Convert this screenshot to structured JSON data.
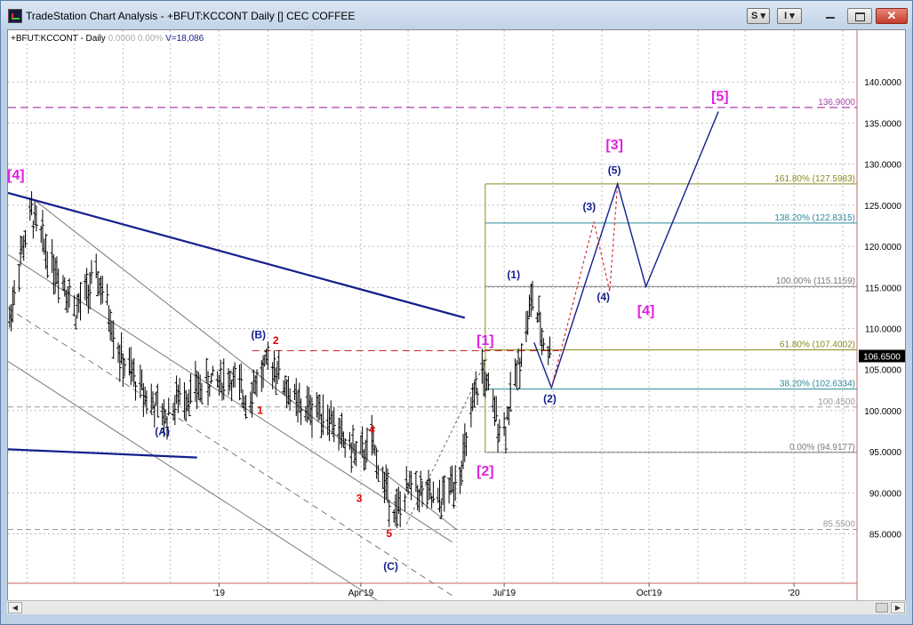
{
  "window": {
    "title": "TradeStation Chart Analysis - +BFUT:KCCONT Daily [] CEC COFFEE",
    "btn_s": "S",
    "btn_i": "I",
    "close_symbol": "✕"
  },
  "colors": {
    "price_bars": "#000000",
    "channel": "#7a7a7a",
    "trend_line": "#141e8c",
    "red_label": "#e00000",
    "magenta_label": "#e020e0",
    "blue_label": "#141e8c",
    "fib": "#7a7a7a",
    "fib_olive": "#8a8a20",
    "fib_teal": "#2a8a9a",
    "target_line": "#b040b0",
    "price_flag_bg": "#000000",
    "price_flag_fg": "#ffffff"
  },
  "chart_data": {
    "type": "ohlc-bar",
    "symbol_line": {
      "symbol": "+BFUT:KCCONT - Daily",
      "last": "0.0000",
      "change": "0.00%",
      "volume": "V=18,086"
    },
    "xaxis": {
      "tick_labels": [
        "'19",
        "Apr'19",
        "Jul'19",
        "Oct'19",
        "'20"
      ],
      "tick_dates": [
        "2019-01-01",
        "2019-04-01",
        "2019-07-01",
        "2019-10-01",
        "2020-01-01"
      ],
      "range": [
        "2018-08-20",
        "2020-02-10"
      ]
    },
    "yaxis": {
      "range": [
        79.0,
        146.3
      ],
      "tick_labels": [
        "85.0000",
        "90.0000",
        "95.0000",
        "100.0000",
        "105.0000",
        "110.0000",
        "115.0000",
        "120.0000",
        "125.0000",
        "130.0000",
        "135.0000",
        "140.0000"
      ],
      "ticks": [
        85,
        90,
        95,
        100,
        105,
        110,
        115,
        120,
        125,
        130,
        135,
        140
      ],
      "current_price_label": "106.6500",
      "current_price": 106.65
    },
    "price_series": [
      {
        "date": "2018-08-21",
        "value": 111.0
      },
      {
        "date": "2018-08-27",
        "value": 118.0
      },
      {
        "date": "2018-09-04",
        "value": 124.0
      },
      {
        "date": "2018-09-10",
        "value": 121.0
      },
      {
        "date": "2018-09-17",
        "value": 118.0
      },
      {
        "date": "2018-09-25",
        "value": 115.5
      },
      {
        "date": "2018-10-02",
        "value": 112.0
      },
      {
        "date": "2018-10-09",
        "value": 114.5
      },
      {
        "date": "2018-10-16",
        "value": 116.0
      },
      {
        "date": "2018-10-23",
        "value": 112.0
      },
      {
        "date": "2018-10-31",
        "value": 106.0
      },
      {
        "date": "2018-11-08",
        "value": 104.0
      },
      {
        "date": "2018-11-19",
        "value": 101.0
      },
      {
        "date": "2018-11-28",
        "value": 99.0
      },
      {
        "date": "2018-12-06",
        "value": 101.5
      },
      {
        "date": "2018-12-17",
        "value": 102.5
      },
      {
        "date": "2018-12-27",
        "value": 103.5
      },
      {
        "date": "2019-01-08",
        "value": 104.0
      },
      {
        "date": "2019-01-18",
        "value": 101.5
      },
      {
        "date": "2019-01-28",
        "value": 104.5
      },
      {
        "date": "2019-02-04",
        "value": 106.0
      },
      {
        "date": "2019-02-12",
        "value": 103.0
      },
      {
        "date": "2019-02-22",
        "value": 100.0
      },
      {
        "date": "2019-03-04",
        "value": 100.5
      },
      {
        "date": "2019-03-13",
        "value": 99.0
      },
      {
        "date": "2019-03-22",
        "value": 96.0
      },
      {
        "date": "2019-04-01",
        "value": 94.5
      },
      {
        "date": "2019-04-08",
        "value": 96.0
      },
      {
        "date": "2019-04-15",
        "value": 91.5
      },
      {
        "date": "2019-04-24",
        "value": 87.5
      },
      {
        "date": "2019-05-03",
        "value": 91.0
      },
      {
        "date": "2019-05-10",
        "value": 90.0
      },
      {
        "date": "2019-05-20",
        "value": 88.5
      },
      {
        "date": "2019-05-29",
        "value": 91.0
      },
      {
        "date": "2019-06-05",
        "value": 94.0
      },
      {
        "date": "2019-06-12",
        "value": 101.0
      },
      {
        "date": "2019-06-17",
        "value": 105.0
      },
      {
        "date": "2019-06-24",
        "value": 100.0
      },
      {
        "date": "2019-07-01",
        "value": 97.5
      },
      {
        "date": "2019-07-08",
        "value": 104.0
      },
      {
        "date": "2019-07-15",
        "value": 110.0
      },
      {
        "date": "2019-07-19",
        "value": 114.0
      },
      {
        "date": "2019-07-25",
        "value": 109.0
      },
      {
        "date": "2019-07-31",
        "value": 106.5
      }
    ],
    "channel_lines": [
      {
        "style": "solid",
        "points": [
          {
            "date": "2018-08-20",
            "value": 119.0
          },
          {
            "date": "2019-05-29",
            "value": 84.0
          }
        ]
      },
      {
        "style": "dashed",
        "points": [
          {
            "date": "2018-08-20",
            "value": 112.5
          },
          {
            "date": "2019-05-29",
            "value": 77.5
          }
        ]
      },
      {
        "style": "solid",
        "points": [
          {
            "date": "2018-08-20",
            "value": 106.0
          },
          {
            "date": "2019-05-29",
            "value": 71.0
          }
        ]
      },
      {
        "style": "solid",
        "points": [
          {
            "date": "2018-09-06",
            "value": 125.6
          },
          {
            "date": "2019-06-01",
            "value": 85.5
          }
        ]
      }
    ],
    "trend_lines": [
      {
        "points": [
          {
            "date": "2018-08-20",
            "value": 126.5
          },
          {
            "date": "2019-06-06",
            "value": 111.3
          }
        ]
      },
      {
        "points": [
          {
            "date": "2018-08-20",
            "value": 95.3
          },
          {
            "date": "2018-12-18",
            "value": 94.3
          }
        ]
      }
    ],
    "dotted_line": {
      "points": [
        {
          "date": "2019-04-30",
          "value": 86.2
        },
        {
          "date": "2019-06-20",
          "value": 106.3
        }
      ]
    },
    "red_dashed_line": {
      "points": [
        {
          "date": "2019-01-22",
          "value": 107.3
        },
        {
          "date": "2019-08-05",
          "value": 107.3
        }
      ]
    },
    "projection_solid": [
      {
        "date": "2019-07-20",
        "value": 108.3
      },
      {
        "date": "2019-07-31",
        "value": 102.8
      },
      {
        "date": "2019-09-11",
        "value": 127.6
      },
      {
        "date": "2019-09-29",
        "value": 115.1
      },
      {
        "date": "2019-11-14",
        "value": 136.4
      }
    ],
    "projection_dotted": [
      {
        "date": "2019-07-31",
        "value": 102.8
      },
      {
        "date": "2019-08-27",
        "value": 123.0
      },
      {
        "date": "2019-09-06",
        "value": 114.5
      },
      {
        "date": "2019-09-11",
        "value": 127.6
      }
    ],
    "fib_levels": [
      {
        "label": "161.80% (127.5983)",
        "value": 127.5983,
        "color": "#8a8a20"
      },
      {
        "label": "138.20% (122.8315)",
        "value": 122.8315,
        "color": "#2a8a9a"
      },
      {
        "label": "100.00% (115.1159)",
        "value": 115.1159,
        "color": "#7a7a7a"
      },
      {
        "label": "61.80% (107.4002)",
        "value": 107.4002,
        "color": "#8a8a20"
      },
      {
        "label": "38.20% (102.6334)",
        "value": 102.6334,
        "color": "#2a8a9a"
      },
      {
        "label": "0.00% (94.9177)",
        "value": 94.9177,
        "color": "#7a7a7a"
      }
    ],
    "fib_start_date": "2019-06-19",
    "horizontal_levels": [
      {
        "label": "136.9000",
        "value": 136.9,
        "style": "target"
      },
      {
        "label": "100.4500",
        "value": 100.45,
        "style": "dashed"
      },
      {
        "label": "85.5500",
        "value": 85.55,
        "style": "dashed"
      }
    ],
    "wave_labels": [
      {
        "text": "[4]",
        "date": "2018-08-25",
        "value": 128.1,
        "color": "magenta",
        "size": 16
      },
      {
        "text": "(A)",
        "date": "2018-11-26",
        "value": 97.0,
        "color": "blue",
        "size": 12
      },
      {
        "text": "(B)",
        "date": "2019-01-26",
        "value": 108.8,
        "color": "blue",
        "size": 12
      },
      {
        "text": "2",
        "date": "2019-02-06",
        "value": 108.1,
        "color": "red",
        "size": 12
      },
      {
        "text": "1",
        "date": "2019-01-27",
        "value": 99.6,
        "color": "red",
        "size": 12
      },
      {
        "text": "4",
        "date": "2019-04-08",
        "value": 97.3,
        "color": "red",
        "size": 12
      },
      {
        "text": "3",
        "date": "2019-03-31",
        "value": 88.9,
        "color": "red",
        "size": 12
      },
      {
        "text": "5",
        "date": "2019-04-19",
        "value": 84.6,
        "color": "red",
        "size": 12
      },
      {
        "text": "(C)",
        "date": "2019-04-20",
        "value": 80.6,
        "color": "blue",
        "size": 12
      },
      {
        "text": "[1]",
        "date": "2019-06-19",
        "value": 108.0,
        "color": "magenta",
        "size": 16
      },
      {
        "text": "[2]",
        "date": "2019-06-19",
        "value": 92.1,
        "color": "magenta",
        "size": 16
      },
      {
        "text": "(1)",
        "date": "2019-07-07",
        "value": 116.1,
        "color": "blue",
        "size": 12
      },
      {
        "text": "(2)",
        "date": "2019-07-30",
        "value": 101.0,
        "color": "blue",
        "size": 12
      },
      {
        "text": "(3)",
        "date": "2019-08-24",
        "value": 124.4,
        "color": "blue",
        "size": 12
      },
      {
        "text": "(4)",
        "date": "2019-09-02",
        "value": 113.4,
        "color": "blue",
        "size": 12
      },
      {
        "text": "(5)",
        "date": "2019-09-09",
        "value": 128.8,
        "color": "blue",
        "size": 12
      },
      {
        "text": "[3]",
        "date": "2019-09-09",
        "value": 131.8,
        "color": "magenta",
        "size": 16
      },
      {
        "text": "[4]",
        "date": "2019-09-29",
        "value": 111.6,
        "color": "magenta",
        "size": 16
      },
      {
        "text": "[5]",
        "date": "2019-11-15",
        "value": 137.7,
        "color": "magenta",
        "size": 16
      }
    ]
  }
}
